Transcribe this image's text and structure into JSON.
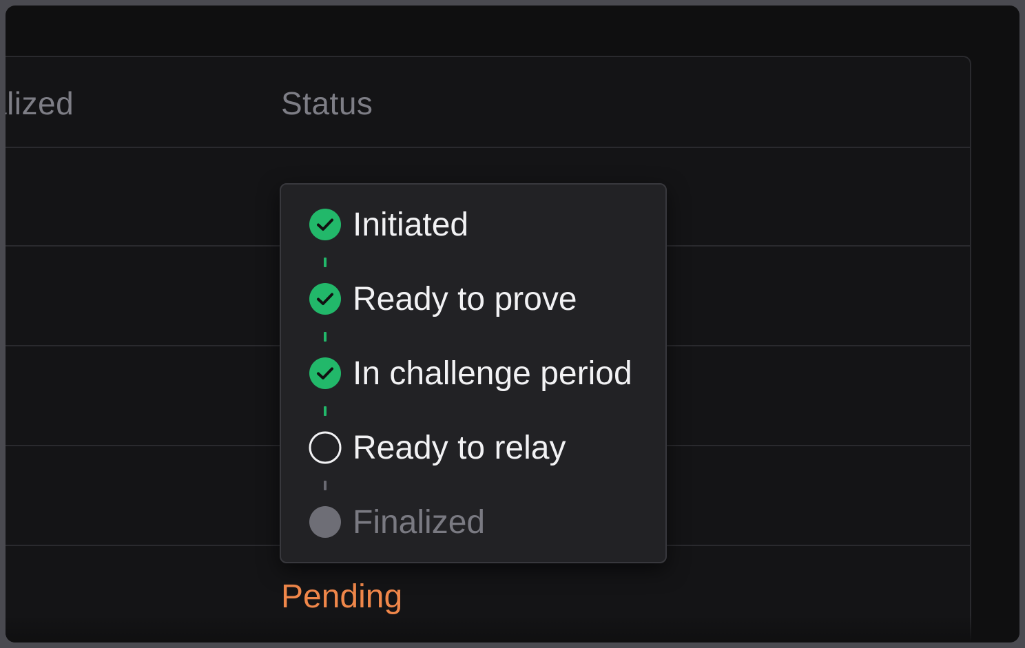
{
  "table": {
    "columns": [
      {
        "key": "finalized",
        "label": "alized"
      },
      {
        "key": "status",
        "label": "Status"
      }
    ],
    "last_row_status": "Pending"
  },
  "status_popover": {
    "steps": [
      {
        "label": "Initiated",
        "state": "complete",
        "icon": "check-circle-icon"
      },
      {
        "label": "Ready to prove",
        "state": "complete",
        "icon": "check-circle-icon"
      },
      {
        "label": "In challenge period",
        "state": "complete",
        "icon": "check-circle-icon"
      },
      {
        "label": "Ready to relay",
        "state": "current",
        "icon": "empty-circle-icon"
      },
      {
        "label": "Finalized",
        "state": "upcoming",
        "icon": "filled-gray-circle-icon"
      }
    ]
  },
  "colors": {
    "complete": "#22b86a",
    "pending": "#f0874a",
    "muted": "#7a7a82",
    "background": "#0f0f10",
    "popover": "#222225"
  }
}
